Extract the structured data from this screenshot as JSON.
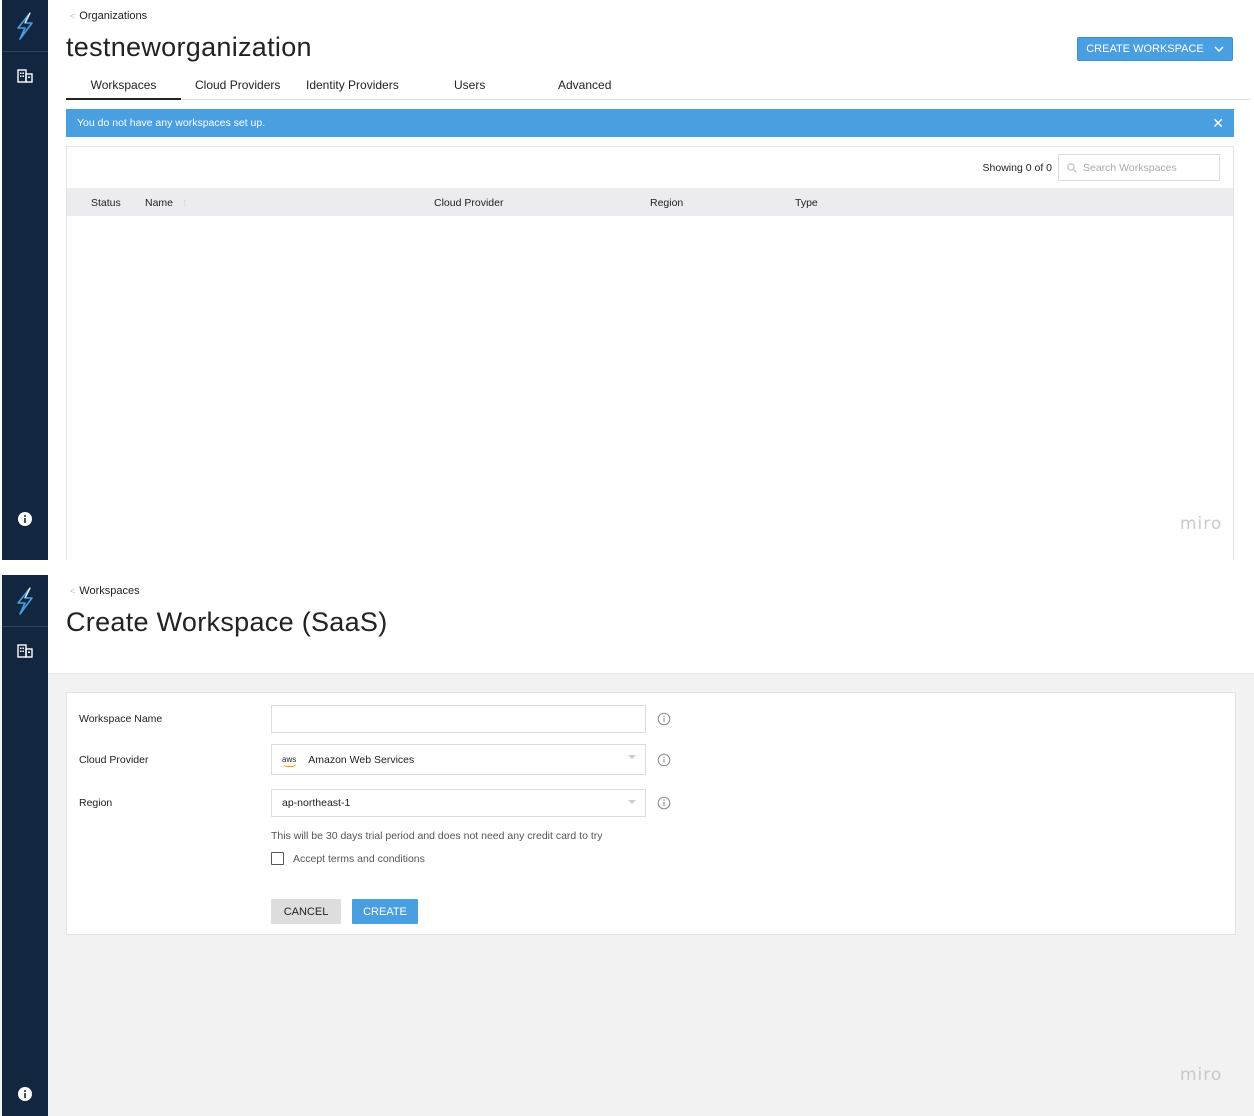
{
  "colors": {
    "sidebar": "#13263f",
    "accent": "#4a9fe0",
    "table_header": "#ebebf0",
    "page_bg_create": "#f2f2f2"
  },
  "sidebar": {
    "logo_icon": "lightning-bolt-icon",
    "org_icon": "building-icon",
    "info_icon": "info-circle-icon"
  },
  "orgs_page": {
    "breadcrumb": "Organizations",
    "title": "testneworganization",
    "create_workspace_button": "CREATE WORKSPACE",
    "tabs": [
      {
        "label": "Workspaces",
        "active": true
      },
      {
        "label": "Cloud Providers",
        "active": false
      },
      {
        "label": "Identity Providers",
        "active": false
      },
      {
        "label": "Users",
        "active": false
      },
      {
        "label": "Advanced",
        "active": false
      }
    ],
    "alert": "You do not have any workspaces set up.",
    "showing": "Showing 0 of 0",
    "search_placeholder": "Search Workspaces",
    "columns": [
      "Status",
      "Name",
      "Cloud Provider",
      "Region",
      "Type"
    ],
    "rows": [],
    "watermark": "miro"
  },
  "create_page": {
    "breadcrumb": "Workspaces",
    "title": "Create Workspace (SaaS)",
    "fields": {
      "workspace_name_label": "Workspace Name",
      "workspace_name_value": "",
      "cloud_provider_label": "Cloud Provider",
      "cloud_provider_logo": "aws",
      "cloud_provider_value": "Amazon Web Services",
      "region_label": "Region",
      "region_value": "ap-northeast-1"
    },
    "trial_note": "This will be 30 days trial period and does not need any credit card to try",
    "terms_label": "Accept terms and conditions",
    "terms_checked": false,
    "cancel_button": "CANCEL",
    "create_button": "CREATE",
    "watermark": "miro"
  }
}
